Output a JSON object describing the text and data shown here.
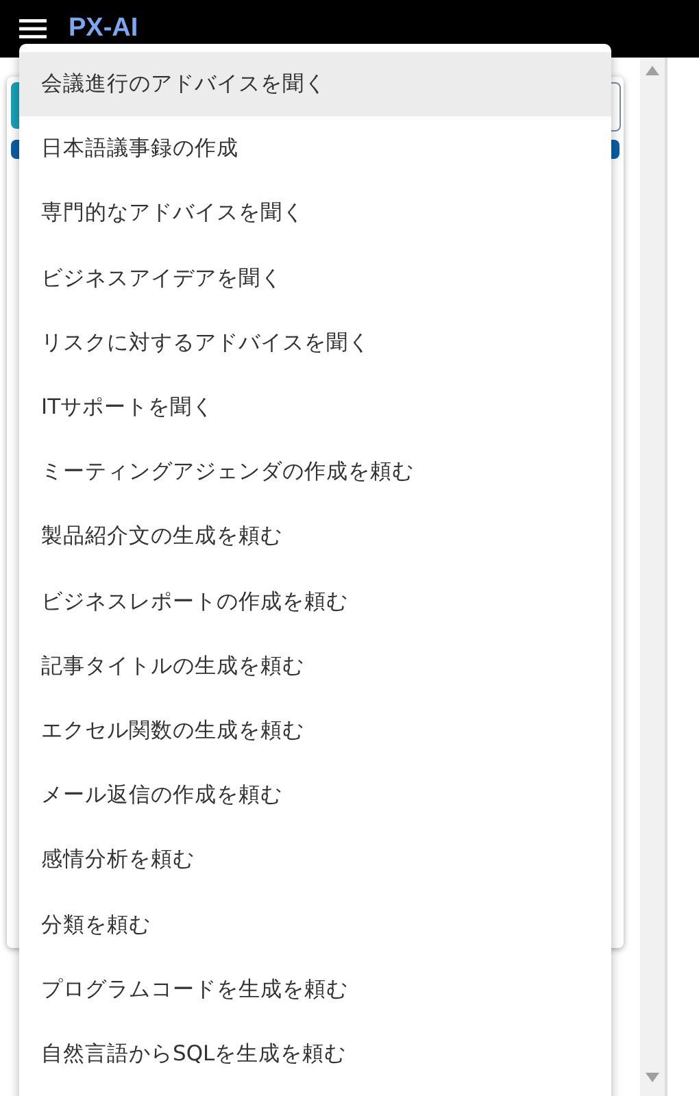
{
  "header": {
    "title": "PX-AI"
  },
  "menu": {
    "items": [
      {
        "label": "会議進行のアドバイスを聞く",
        "selected": true
      },
      {
        "label": "日本語議事録の作成",
        "selected": false
      },
      {
        "label": "専門的なアドバイスを聞く",
        "selected": false
      },
      {
        "label": "ビジネスアイデアを聞く",
        "selected": false
      },
      {
        "label": "リスクに対するアドバイスを聞く",
        "selected": false
      },
      {
        "label": "ITサポートを聞く",
        "selected": false
      },
      {
        "label": "ミーティングアジェンダの作成を頼む",
        "selected": false
      },
      {
        "label": "製品紹介文の生成を頼む",
        "selected": false
      },
      {
        "label": "ビジネスレポートの作成を頼む",
        "selected": false
      },
      {
        "label": "記事タイトルの生成を頼む",
        "selected": false
      },
      {
        "label": "エクセル関数の生成を頼む",
        "selected": false
      },
      {
        "label": "メール返信の作成を頼む",
        "selected": false
      },
      {
        "label": "感情分析を頼む",
        "selected": false
      },
      {
        "label": "分類を頼む",
        "selected": false
      },
      {
        "label": "プログラムコードを生成を頼む",
        "selected": false
      },
      {
        "label": "自然言語からSQLを生成を頼む",
        "selected": false
      }
    ]
  }
}
